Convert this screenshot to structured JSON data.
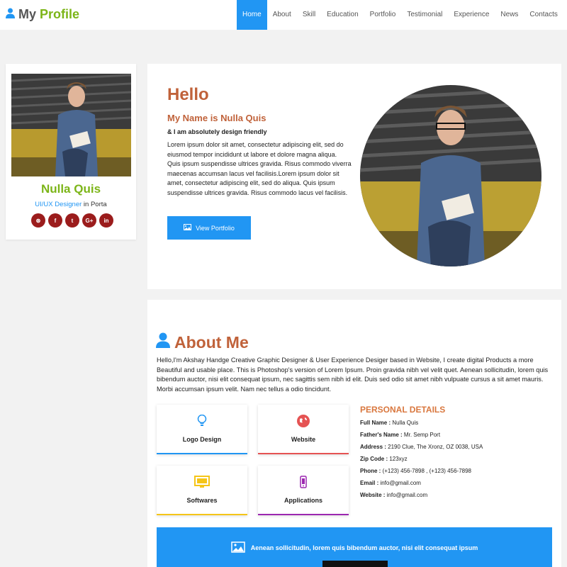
{
  "header": {
    "logo_my": "My",
    "logo_profile": "Profile",
    "nav": [
      "Home",
      "About",
      "Skill",
      "Education",
      "Portfolio",
      "Testimonial",
      "Experience",
      "News",
      "Contacts"
    ],
    "active_nav": "Home"
  },
  "profile_card": {
    "name": "Nulla Quis",
    "role": "UI/UX Designer",
    "location": " in Porta",
    "social": [
      {
        "icon": "rss-icon",
        "glyph": "⊛"
      },
      {
        "icon": "facebook-icon",
        "glyph": "f"
      },
      {
        "icon": "twitter-icon",
        "glyph": "t"
      },
      {
        "icon": "google-plus-icon",
        "glyph": "G+"
      },
      {
        "icon": "linkedin-icon",
        "glyph": "in"
      }
    ]
  },
  "hero": {
    "greeting": "Hello",
    "name_line": "My Name is Nulla Quis",
    "tagline": "& I am absolutely design friendly",
    "intro": "Lorem ipsum dolor sit amet, consectetur adipiscing elit, sed do eiusmod tempor incididunt ut labore et dolore magna aliqua. Quis ipsum suspendisse ultrices gravida. Risus commodo viverra maecenas accumsan lacus vel facilisis.Lorem ipsum dolor sit amet, consectetur adipiscing elit, sed do aliqua. Quis ipsum suspendisse ultrices gravida. Risus commodo lacus vel facilisis.",
    "button_label": "View Portfolio"
  },
  "about": {
    "title": "About Me",
    "text": "Hello,I'm Akshay Handge Creative Graphic Designer & User Experience Desiger based in Website, I create digital Products a more Beautiful and usable place. This is Photoshop's version of Lorem Ipsum. Proin gravida nibh vel velit quet. Aenean sollicitudin, lorem quis bibendum auctor, nisi elit consequat ipsum, nec sagittis sem nibh id elit. Duis sed odio sit amet nibh vulpuate cursus a sit amet mauris. Morbi accumsan ipsum velit. Nam nec tellus a odio tincidunt.",
    "services": [
      {
        "label": "Logo Design",
        "icon": "lightbulb-icon",
        "color": "#2196f3"
      },
      {
        "label": "Website",
        "icon": "globe-icon",
        "color": "#e55353"
      },
      {
        "label": "Softwares",
        "icon": "monitor-icon",
        "color": "#f5c518"
      },
      {
        "label": "Applications",
        "icon": "mobile-icon",
        "color": "#9c27b0"
      }
    ],
    "personal_title": "PERSONAL DETAILS",
    "personal": [
      {
        "label": "Full Name :",
        "value": " Nulla Quis"
      },
      {
        "label": "Father's Name :",
        "value": " Mr. Semp Port"
      },
      {
        "label": "Address :",
        "value": " 2190 Clue, The Xronz, OZ 0038, USA"
      },
      {
        "label": "Zip Code :",
        "value": " 123xyz"
      },
      {
        "label": "Phone :",
        "value": " (+123) 456-7898 , (+123) 456-7898"
      },
      {
        "label": "Email :",
        "value": " info@gmail.com"
      },
      {
        "label": "Website :",
        "value": " info@gmail.com"
      }
    ],
    "banner_text": "Aenean sollicitudin, lorem quis bibendum auctor, nisi elit consequat ipsum"
  },
  "colors": {
    "accent": "#2196f3",
    "brand_green": "#7cb518",
    "heading": "#c0623a",
    "social": "#9b1c1c"
  }
}
